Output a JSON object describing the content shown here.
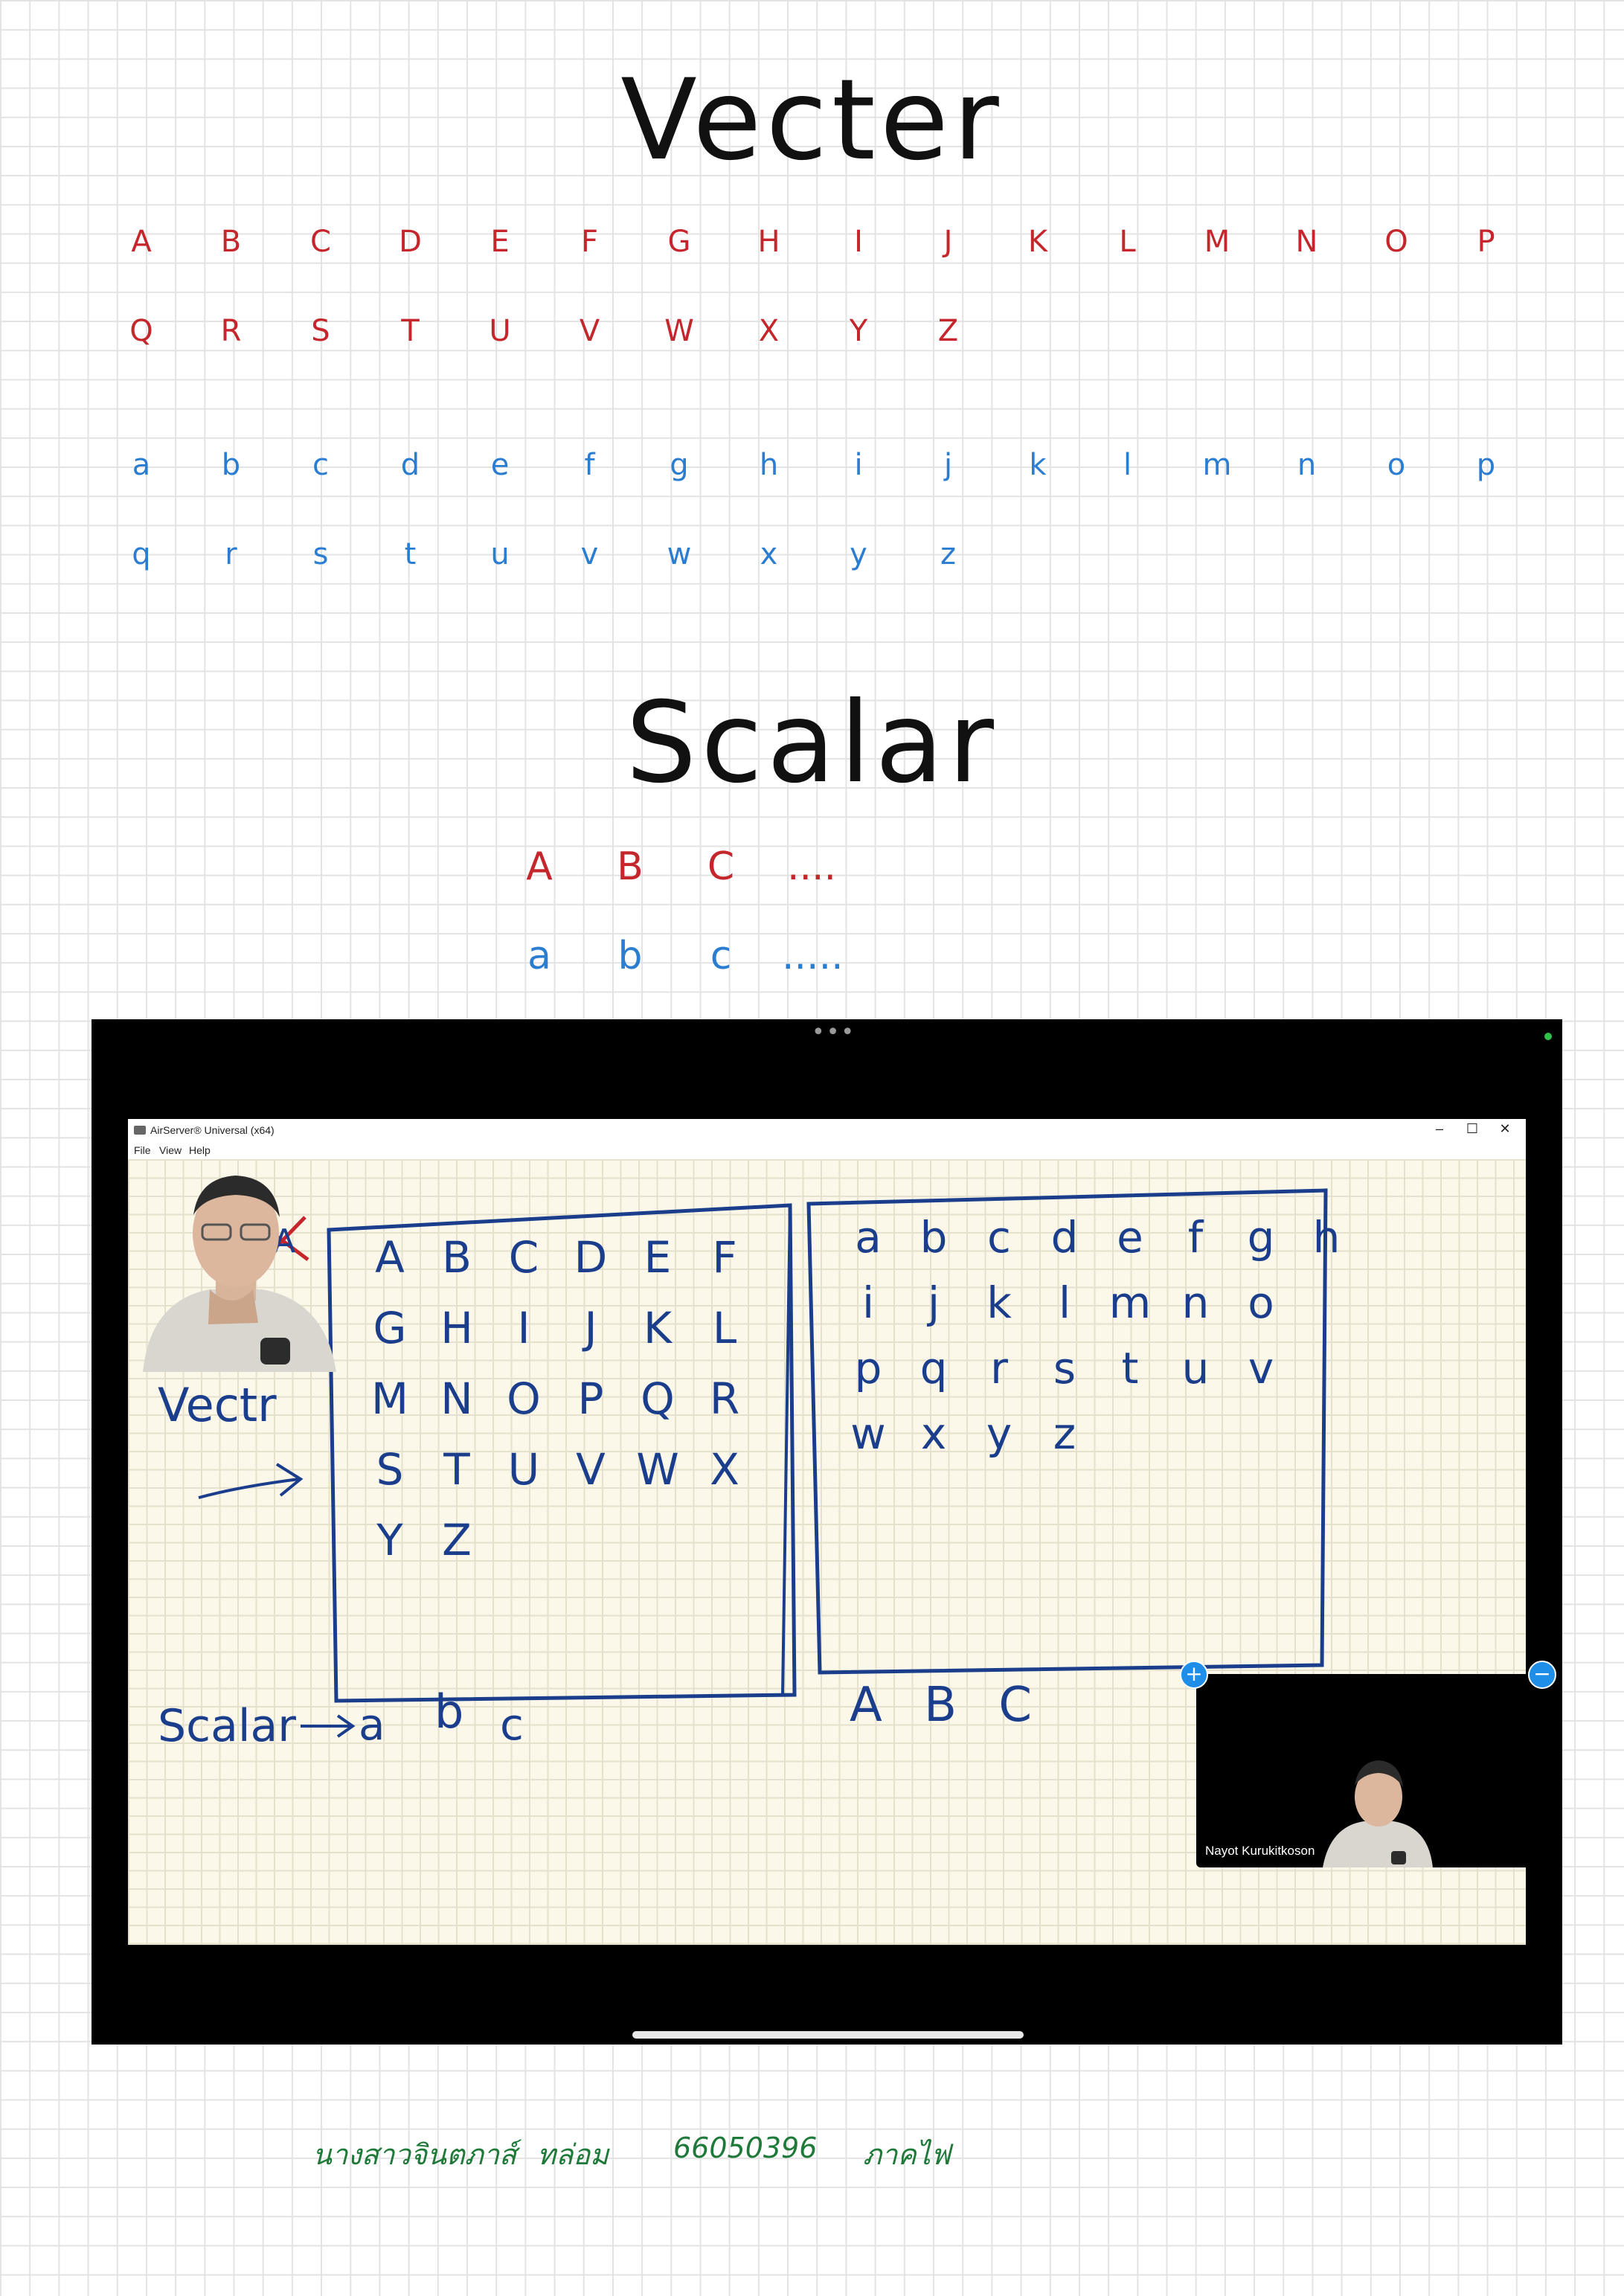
{
  "vector_section": {
    "title": "Vecter",
    "upper_row1": [
      "A",
      "B",
      "C",
      "D",
      "E",
      "F",
      "G",
      "H",
      "I",
      "J",
      "K",
      "L",
      "M",
      "N",
      "O",
      "P"
    ],
    "upper_row2": [
      "Q",
      "R",
      "S",
      "T",
      "U",
      "V",
      "W",
      "X",
      "Y",
      "Z"
    ],
    "lower_row1": [
      "a",
      "b",
      "c",
      "d",
      "e",
      "f",
      "g",
      "h",
      "i",
      "j",
      "k",
      "l",
      "m",
      "n",
      "o",
      "p"
    ],
    "lower_row2": [
      "q",
      "r",
      "s",
      "t",
      "u",
      "v",
      "w",
      "x",
      "y",
      "z"
    ]
  },
  "scalar_section": {
    "title": "Scalar",
    "upper": [
      "A",
      "B",
      "C",
      "...."
    ],
    "lower": [
      "a",
      "b",
      "c",
      "....."
    ]
  },
  "screenshot": {
    "app_title": "AirServer® Universal (x64)",
    "menu": [
      "File",
      "View",
      "Help"
    ],
    "window_controls": [
      "–",
      "☐",
      "✕"
    ],
    "board": {
      "crossed_letter": "A",
      "vector_label": "Vectr",
      "scalar_label": "Scalar",
      "scalar_letters": [
        "a",
        "b",
        "c"
      ],
      "upper_box_rows": [
        [
          "A",
          "B",
          "C",
          "D",
          "E",
          "F"
        ],
        [
          "G",
          "H",
          "I",
          "J",
          "K",
          "L"
        ],
        [
          "M",
          "N",
          "O",
          "P",
          "Q",
          "R"
        ],
        [
          "S",
          "T",
          "U",
          "V",
          "W",
          "X"
        ],
        [
          "Y",
          "Z"
        ]
      ],
      "lower_box_rows": [
        [
          "a",
          "b",
          "c",
          "d",
          "e",
          "f",
          "g",
          "h"
        ],
        [
          "i",
          "j",
          "k",
          "l",
          "m",
          "n",
          "o"
        ],
        [
          "p",
          "q",
          "r",
          "s",
          "t",
          "u",
          "v"
        ],
        [
          "w",
          "x",
          "y",
          "z"
        ]
      ],
      "abc_right": "A B C"
    },
    "pip_name": "Nayot Kurukitkoson",
    "pip_plus": "+",
    "pip_minus": "−",
    "colors": {
      "ink": "#1a3d8c",
      "red_ink": "#c4262b",
      "accent": "#1e8ee8"
    },
    "icons": [
      "app-icon",
      "more-dots-icon",
      "plus-icon",
      "minus-icon",
      "arrow-icon"
    ]
  },
  "footer": {
    "name": "นางสาวจินตภาส์",
    "nickname": "ทล่อม",
    "student_id": "66050396",
    "department": "ภาคไฟ"
  }
}
